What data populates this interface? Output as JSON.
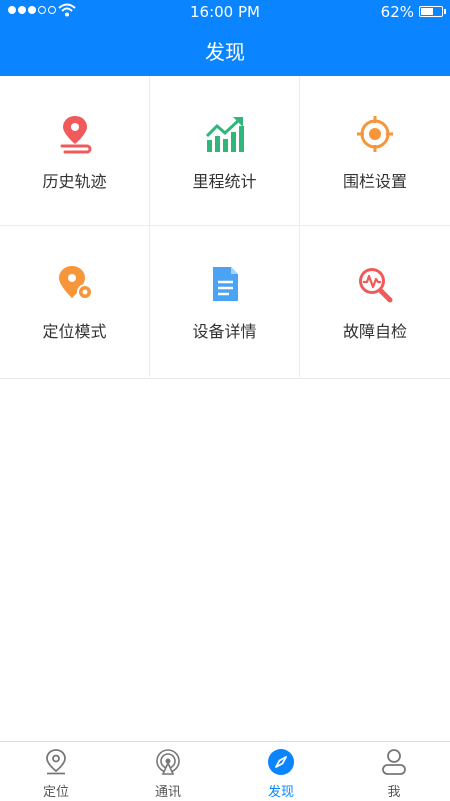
{
  "status_bar": {
    "time": "16:00 PM",
    "battery": "62%",
    "battery_level": 0.62,
    "signal_bars": 3
  },
  "header": {
    "title": "发现"
  },
  "grid": [
    {
      "label": "历史轨迹",
      "icon": "map-pin-route-icon",
      "color": "#f05a5a"
    },
    {
      "label": "里程统计",
      "icon": "trend-chart-icon",
      "color": "#2fb67a"
    },
    {
      "label": "围栏设置",
      "icon": "geofence-target-icon",
      "color": "#f6953a"
    },
    {
      "label": "定位模式",
      "icon": "location-mode-icon",
      "color": "#f6953a"
    },
    {
      "label": "设备详情",
      "icon": "document-icon",
      "color": "#4aa3f5"
    },
    {
      "label": "故障自检",
      "icon": "diagnostic-search-icon",
      "color": "#f05a5a"
    }
  ],
  "tabbar": {
    "active": "发现",
    "accent": "#0a84ff",
    "items": [
      {
        "label": "定位",
        "icon": "location-pin-icon"
      },
      {
        "label": "通讯",
        "icon": "broadcast-icon"
      },
      {
        "label": "发现",
        "icon": "compass-icon"
      },
      {
        "label": "我",
        "icon": "user-icon"
      }
    ]
  }
}
